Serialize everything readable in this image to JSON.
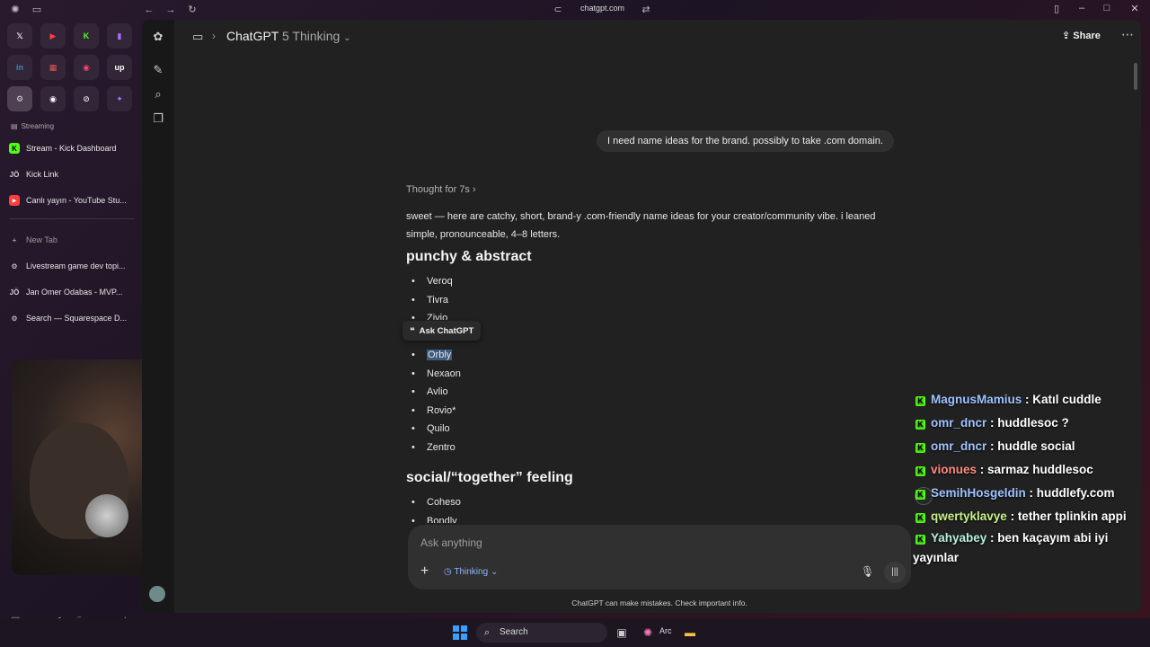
{
  "browser": {
    "url": "chatgpt.com"
  },
  "sidebar": {
    "favorites": [
      {
        "icon": "x-icon",
        "glyph": "𝕏",
        "color": "#ffffff"
      },
      {
        "icon": "youtube-icon",
        "glyph": "▶",
        "color": "#ff3d3d"
      },
      {
        "icon": "kick-icon",
        "glyph": "K",
        "color": "#53fc18"
      },
      {
        "icon": "twitch-icon",
        "glyph": "▮",
        "color": "#a970ff"
      },
      {
        "icon": "linkedin-icon",
        "glyph": "in",
        "color": "#2d8cdb"
      },
      {
        "icon": "calendar-icon",
        "glyph": "▦",
        "color": "#e05a4a"
      },
      {
        "icon": "record-icon",
        "glyph": "◉",
        "color": "#ff4466"
      },
      {
        "icon": "upwork-icon",
        "glyph": "up",
        "color": "#ffffff"
      },
      {
        "icon": "chatgpt-icon",
        "glyph": "⚙",
        "color": "#dddddd"
      },
      {
        "icon": "play-circle-icon",
        "glyph": "◉",
        "color": "#ffffff"
      },
      {
        "icon": "perplexity-icon",
        "glyph": "⊘",
        "color": "#dddddd"
      },
      {
        "icon": "gemini-icon",
        "glyph": "✦",
        "color": "#8a7dff"
      }
    ],
    "section_label": "Streaming",
    "items": [
      {
        "label": "Stream - Kick Dashboard",
        "icon": "kick-icon",
        "glyph": "K",
        "color": "#53fc18"
      },
      {
        "label": "Kick Link",
        "icon": "initials-icon",
        "glyph": "JÖ",
        "color": "#cfcfcf"
      },
      {
        "label": "Canlı yayın - YouTube Stu...",
        "icon": "youtube-icon",
        "glyph": "▶",
        "color": "#ff3d3d"
      }
    ],
    "new_tab": "New Tab",
    "tabs": [
      {
        "label": "Livestream game dev topi...",
        "icon": "chatgpt-icon",
        "glyph": "⚙",
        "color": "#dddddd"
      },
      {
        "label": "Jan Omer Odabas - MVP...",
        "icon": "initials-icon",
        "glyph": "JÖ",
        "color": "#cfcfcf"
      },
      {
        "label": "Search — Squarespace D...",
        "icon": "chatgpt-icon",
        "glyph": "⚙",
        "color": "#dddddd"
      }
    ]
  },
  "header": {
    "model_name": "ChatGPT",
    "model_variant": "5 Thinking",
    "share_label": "Share"
  },
  "conversation": {
    "user_message": "I need name ideas for the brand. possibly to take .com domain.",
    "thought_label": "Thought for 7s",
    "intro": "sweet — here are catchy, short, brand-y .com-friendly name ideas for your creator/community vibe. i leaned simple, pronounceable, 4–8 letters.",
    "section1_title": "punchy & abstract",
    "section1_items": [
      "Veroq",
      "Tivra",
      "Zivio"
    ],
    "highlighted_item": "Orbly",
    "section1_more": [
      "Nexaon",
      "Avlio",
      "Rovio*",
      "Quilo",
      "Zentro"
    ],
    "ask_popup": "Ask ChatGPT",
    "section2_title": "social/“together” feeling",
    "section2_items": [
      "Coheso",
      "Bondly"
    ]
  },
  "composer": {
    "placeholder": "Ask anything",
    "mode_label": "Thinking",
    "disclaimer": "ChatGPT can make mistakes. Check important info."
  },
  "stream_chat": [
    {
      "user": "MagnusMamius",
      "color": "#9ec3ff",
      "message": "Katıl cuddle"
    },
    {
      "user": "omr_dncr",
      "color": "#9ec3ff",
      "message": "huddlesoc ?"
    },
    {
      "user": "omr_dncr",
      "color": "#9ec3ff",
      "message": "huddle social"
    },
    {
      "user": "vionues",
      "color": "#ff8a80",
      "message": "sarmaz huddlesoc"
    },
    {
      "user": "SemihHosgeldin",
      "color": "#9ec3ff",
      "message": "huddlefy.com"
    },
    {
      "user": "qwertyklavye",
      "color": "#c8f08a",
      "message": "tether tplinkin appi"
    },
    {
      "user": "Yahyabey",
      "color": "#b8f0d8",
      "message": "ben kaçayım abi iyi yayınlar"
    }
  ],
  "taskbar": {
    "search_label": "Search",
    "arc_label": "Arc"
  }
}
